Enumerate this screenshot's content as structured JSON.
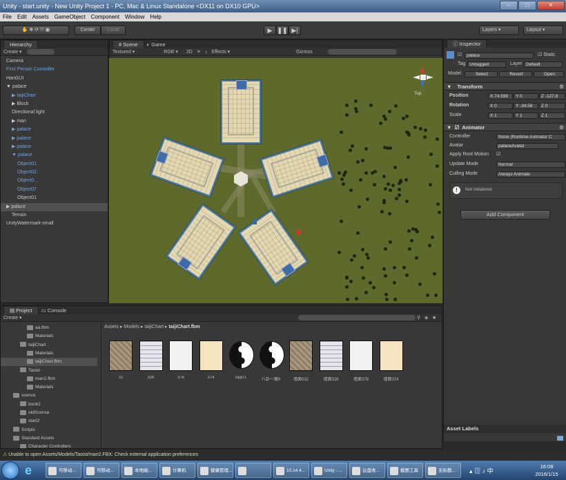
{
  "window": {
    "title": "Unity - start.unity - New Unity Project 1 - PC, Mac & Linux Standalone <DX11 on DX10 GPU>"
  },
  "menu": [
    "File",
    "Edit",
    "Assets",
    "GameObject",
    "Component",
    "Window",
    "Help"
  ],
  "toolbar": {
    "pivot": "Center",
    "space": "Local",
    "layers": "Layers",
    "layout": "Layout"
  },
  "hierarchy": {
    "tab": "Hierarchy",
    "create": "Create",
    "items": [
      {
        "label": "Camera",
        "style": "normal",
        "indent": 0
      },
      {
        "label": "First Person Controller",
        "style": "blue",
        "indent": 0
      },
      {
        "label": "HanGUI",
        "style": "normal",
        "indent": 0
      },
      {
        "label": "▼ palace",
        "style": "normal",
        "indent": 0
      },
      {
        "label": "▶ taijiChart",
        "style": "blue",
        "indent": 1
      },
      {
        "label": "▶ Block",
        "style": "normal",
        "indent": 1
      },
      {
        "label": "Directional light",
        "style": "normal",
        "indent": 1
      },
      {
        "label": "▶ man",
        "style": "normal",
        "indent": 1
      },
      {
        "label": "▶ palace",
        "style": "blue",
        "indent": 1
      },
      {
        "label": "▶ palace",
        "style": "blue",
        "indent": 1
      },
      {
        "label": "▶ palace",
        "style": "blue",
        "indent": 1
      },
      {
        "label": "▼ palace",
        "style": "blue",
        "indent": 1
      },
      {
        "label": "Object01",
        "style": "blue",
        "indent": 2
      },
      {
        "label": "Object02",
        "style": "blue",
        "indent": 2
      },
      {
        "label": "Object0...",
        "style": "blue",
        "indent": 2
      },
      {
        "label": "Object07",
        "style": "blue",
        "indent": 2
      },
      {
        "label": "Object01",
        "style": "normal",
        "indent": 2
      },
      {
        "label": "▶ palace",
        "style": "selected",
        "indent": 0
      },
      {
        "label": "Terrain",
        "style": "normal",
        "indent": 1
      },
      {
        "label": "UnityWatermark-small",
        "style": "normal",
        "indent": 0
      }
    ]
  },
  "scene": {
    "tab_scene": "Scene",
    "tab_game": "Game",
    "shading": "Textured",
    "render": "RGB",
    "mode_2d": "2D",
    "effects": "Effects",
    "gizmos": "Gizmos",
    "view_label": "Top"
  },
  "inspector": {
    "tab": "Inspector",
    "object_name": "palace",
    "static": "Static",
    "tag_label": "Tag",
    "tag_value": "Untagged",
    "layer_label": "Layer",
    "layer_value": "Default",
    "model_label": "Model",
    "select": "Select",
    "revert": "Revert",
    "open": "Open",
    "transform_title": "Transform",
    "position_label": "Position",
    "position": {
      "x": "X 74.599",
      "y": "Y 0",
      "z": "Z -127.8"
    },
    "rotation_label": "Rotation",
    "rotation": {
      "x": "X 0",
      "y": "Y -34.58",
      "z": "Z 0"
    },
    "scale_label": "Scale",
    "scale": {
      "x": "X 1",
      "y": "Y 1",
      "z": "Z 1"
    },
    "animator_title": "Animator",
    "controller_label": "Controller",
    "controller_value": "None (Runtime Animator C",
    "avatar_label": "Avatar",
    "avatar_value": "palaceAvatar",
    "root_motion_label": "Apply Root Motion",
    "update_mode_label": "Update Mode",
    "update_mode_value": "Normal",
    "culling_label": "Culling Mode",
    "culling_value": "Always Animate",
    "not_initialized": "Not initialized",
    "add_component": "Add Component",
    "asset_labels": "Asset Labels"
  },
  "project": {
    "tab_project": "Project",
    "tab_console": "Console",
    "create": "Create",
    "breadcrumb": [
      "Assets",
      "Models",
      "taijiChart"
    ],
    "breadcrumb_current": "taijiChart.fbm",
    "tree": [
      {
        "label": "aa.fbm",
        "indent": 3
      },
      {
        "label": "Materials",
        "indent": 3
      },
      {
        "label": "taijiChart",
        "indent": 2
      },
      {
        "label": "Materials",
        "indent": 3
      },
      {
        "label": "taijiChart.fbm",
        "indent": 3,
        "selected": true
      },
      {
        "label": "Taoist",
        "indent": 2
      },
      {
        "label": "man2.fbm",
        "indent": 3
      },
      {
        "label": "Materials",
        "indent": 3
      },
      {
        "label": "scence",
        "indent": 1
      },
      {
        "label": "book2",
        "indent": 2
      },
      {
        "label": "oldScence",
        "indent": 2
      },
      {
        "label": "start2",
        "indent": 2
      },
      {
        "label": "Scripts",
        "indent": 1
      },
      {
        "label": "Standard Assets",
        "indent": 1
      },
      {
        "label": "Character Controllers",
        "indent": 2
      }
    ],
    "assets": [
      {
        "label": "32",
        "kind": "stone"
      },
      {
        "label": "326",
        "kind": "grid"
      },
      {
        "label": "378",
        "kind": "white"
      },
      {
        "label": "374",
        "kind": "cream"
      },
      {
        "label": "taiji01",
        "kind": "taiji"
      },
      {
        "label": "八卦一魔9",
        "kind": "taiji"
      },
      {
        "label": "墙面032",
        "kind": "stone"
      },
      {
        "label": "墙面326",
        "kind": "grid"
      },
      {
        "label": "墙面378",
        "kind": "white"
      },
      {
        "label": "墙面374",
        "kind": "cream"
      }
    ]
  },
  "status": {
    "warning": "Unable to open Assets/Models/Taoist/man2.FBX: Check external application preferences"
  },
  "taskbar": {
    "items": [
      "可移动...",
      "可移动...",
      "本地磁...",
      "计算机",
      "健康管理...",
      "",
      "10.14.4...",
      "Unity - ...",
      "云盘收...",
      "截图工具",
      "无标题..."
    ],
    "time": "16:08",
    "date": "2016/1/15"
  },
  "colors": {
    "terrain": "#5d6a2c",
    "panel": "#383838",
    "selected": "#505050",
    "link": "#6fa3e0"
  }
}
